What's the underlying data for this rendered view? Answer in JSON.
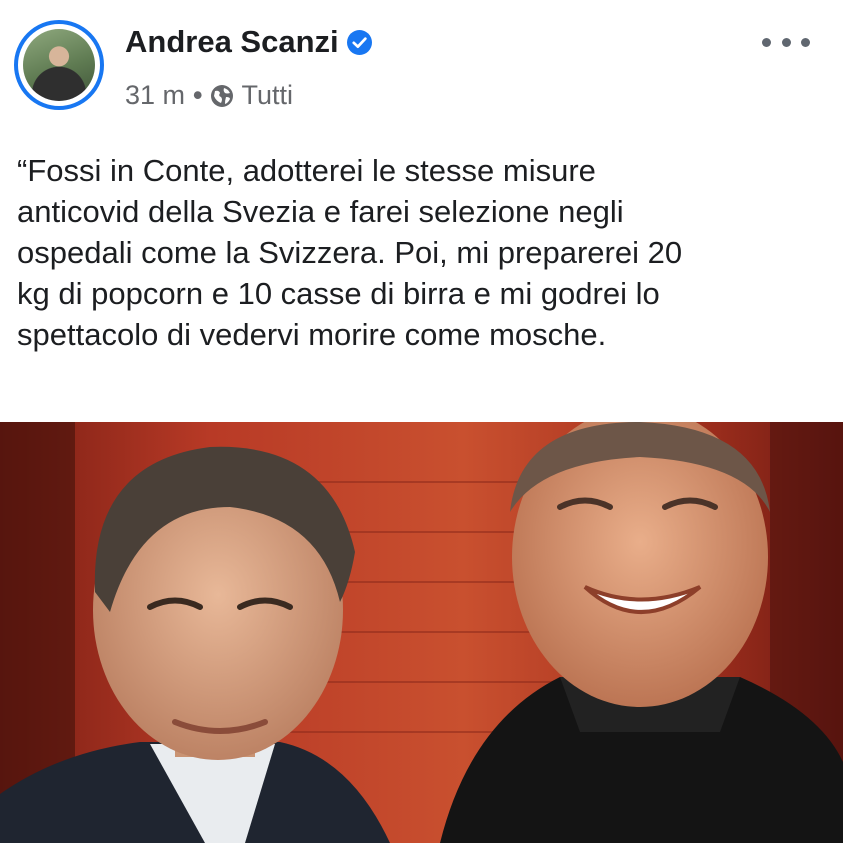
{
  "post": {
    "author": "Andrea Scanzi",
    "verified": true,
    "time": "31 m",
    "separator": "•",
    "audience": "Tutti",
    "text": "“Fossi in Conte, adotterei le stesse misure\nanticovid della Svezia e farei selezione negli\nospedali come la Svizzera. Poi, mi preparerei 20\nkg di popcorn e 10 casse di birra e mi godrei lo\nspettacolo di vedervi morire come mosche.",
    "icons": {
      "verified": "verified-badge-icon",
      "audience": "globe-icon",
      "more": "more-options-icon"
    }
  },
  "colors": {
    "accent": "#1877f2",
    "text": "#1c1e21",
    "secondary": "#65676b",
    "photo_background": "#b83a26"
  }
}
